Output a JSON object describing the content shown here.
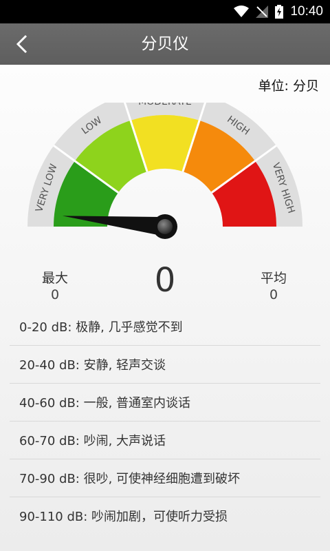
{
  "status_bar": {
    "time": "10:40"
  },
  "app_bar": {
    "title": "分贝仪",
    "back_icon": "chevron-left-icon"
  },
  "unit_label": "单位: 分贝",
  "gauge": {
    "segments": [
      "VERY LOW",
      "LOW",
      "MODERATE",
      "HIGH",
      "VERY HIGH"
    ],
    "colors": [
      "#2a9d1a",
      "#8ed31c",
      "#f2e022",
      "#f58a0c",
      "#e01515"
    ],
    "value_db": 0
  },
  "stats": {
    "max_label": "最大",
    "max_value": "0",
    "current_value": "0",
    "avg_label": "平均",
    "avg_value": "0"
  },
  "ranges": [
    "0-20 dB: 极静, 几乎感觉不到",
    "20-40 dB: 安静, 轻声交谈",
    "40-60 dB: 一般, 普通室内谈话",
    "60-70 dB: 吵闹, 大声说话",
    "70-90 dB: 很吵, 可使神经细胞遭到破坏",
    "90-110 dB: 吵闹加剧，可使听力受损"
  ]
}
